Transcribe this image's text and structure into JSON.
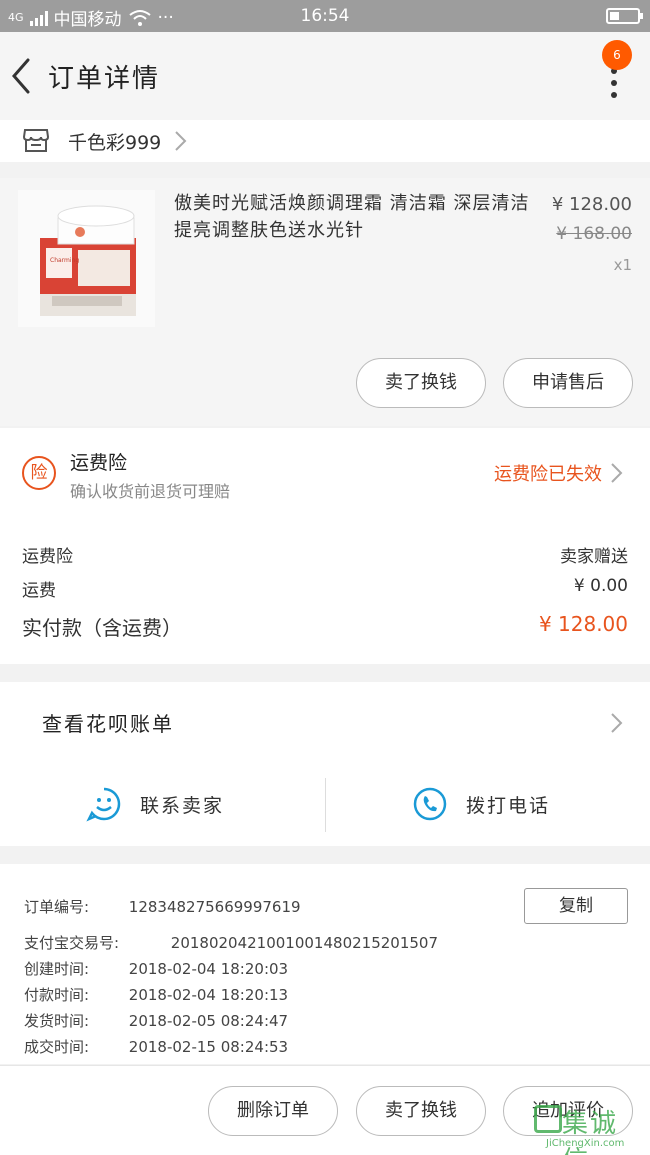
{
  "status_bar": {
    "carrier": "中国移动",
    "network": "4G",
    "dots": "···",
    "time": "16:54"
  },
  "nav": {
    "title": "订单详情",
    "badge_count": "6"
  },
  "shop": {
    "name": "千色彩999"
  },
  "product": {
    "name": "傲美时光赋活焕颜调理霜 清洁霜 深层清洁提亮调整肤色送水光针",
    "price": "¥ 128.00",
    "original_price": "¥ 168.00",
    "quantity": "x1",
    "image_brand": "Charming",
    "buttons": {
      "sell": "卖了换钱",
      "after_sale": "申请售后"
    }
  },
  "insurance": {
    "badge": "险",
    "title": "运费险",
    "subtitle": "确认收货前退货可理赔",
    "status": "运费险已失效"
  },
  "summary": {
    "rows": [
      {
        "label": "运费险",
        "value": "卖家赠送"
      },
      {
        "label": "运费",
        "value": "¥ 0.00"
      }
    ],
    "total_label": "实付款（含运费）",
    "total_value": "¥ 128.00"
  },
  "bill": {
    "label": "查看花呗账单",
    "contact_seller": "联系卖家",
    "call_phone": "拨打电话"
  },
  "order_details": {
    "copy_label": "复制",
    "lines": [
      {
        "key": "订单编号:",
        "value": "128348275669997619"
      },
      {
        "key": "支付宝交易号:",
        "value": "2018020421001001480215201507"
      },
      {
        "key": "创建时间:",
        "value": "2018-02-04 18:20:03"
      },
      {
        "key": "付款时间:",
        "value": "2018-02-04 18:20:13"
      },
      {
        "key": "发货时间:",
        "value": "2018-02-05 08:24:47"
      },
      {
        "key": "成交时间:",
        "value": "2018-02-15 08:24:53"
      }
    ]
  },
  "footer": {
    "delete": "删除订单",
    "sell": "卖了换钱",
    "review": "追加评价"
  },
  "watermark": {
    "text": "集诚信",
    "url": "JiChengXin.com"
  },
  "colors": {
    "accent": "#e8541e",
    "badge": "#ff5a00",
    "icon_blue": "#1a9ad6"
  }
}
